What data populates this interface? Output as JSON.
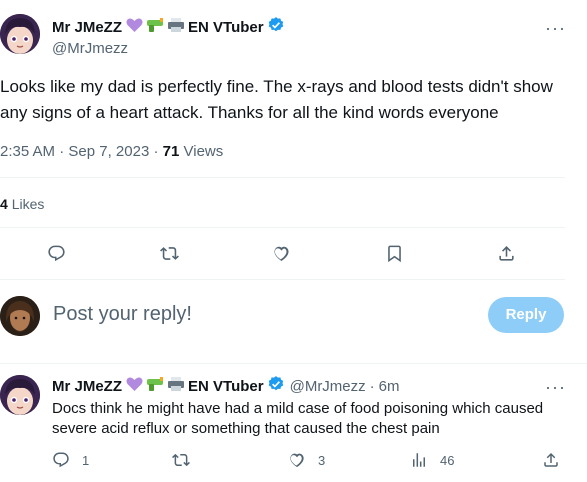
{
  "colors": {
    "accent": "#1d9bf0",
    "muted": "#536471",
    "text": "#0f1419",
    "reply_button": "#8ecdf8",
    "divider": "#eff3f4"
  },
  "main_tweet": {
    "author_name": "Mr JMeZZ",
    "badges": [
      "purple-heart-icon",
      "water-gun-icon",
      "printer-icon"
    ],
    "author_suffix": "EN VTuber",
    "verified": true,
    "handle": "@MrJmezz",
    "text": "Looks like my dad is perfectly fine. The x-rays and blood tests didn't show any signs of a heart attack. Thanks for all the kind words everyone",
    "time": "2:35 AM",
    "dot1": "·",
    "date": "Sep 7, 2023",
    "dot2": "·",
    "views_count": "71",
    "views_label": "Views",
    "likes_count": "4",
    "likes_label": "Likes"
  },
  "action_bar": [
    "reply-icon",
    "retweet-icon",
    "like-icon",
    "bookmark-icon",
    "share-icon"
  ],
  "composer": {
    "placeholder": "Post your reply!",
    "button_label": "Reply"
  },
  "reply_tweet": {
    "author_name": "Mr JMeZZ",
    "author_suffix": "EN VTuber",
    "handle": "@MrJmezz",
    "separator": "·",
    "time_ago": "6m",
    "text_line1": "Docs think he might have had a mild case of food poisoning which caused",
    "text_line2": "severe acid reflux or something that caused the chest pain",
    "replies": "1",
    "retweets": "",
    "likes": "3",
    "views": "46"
  }
}
